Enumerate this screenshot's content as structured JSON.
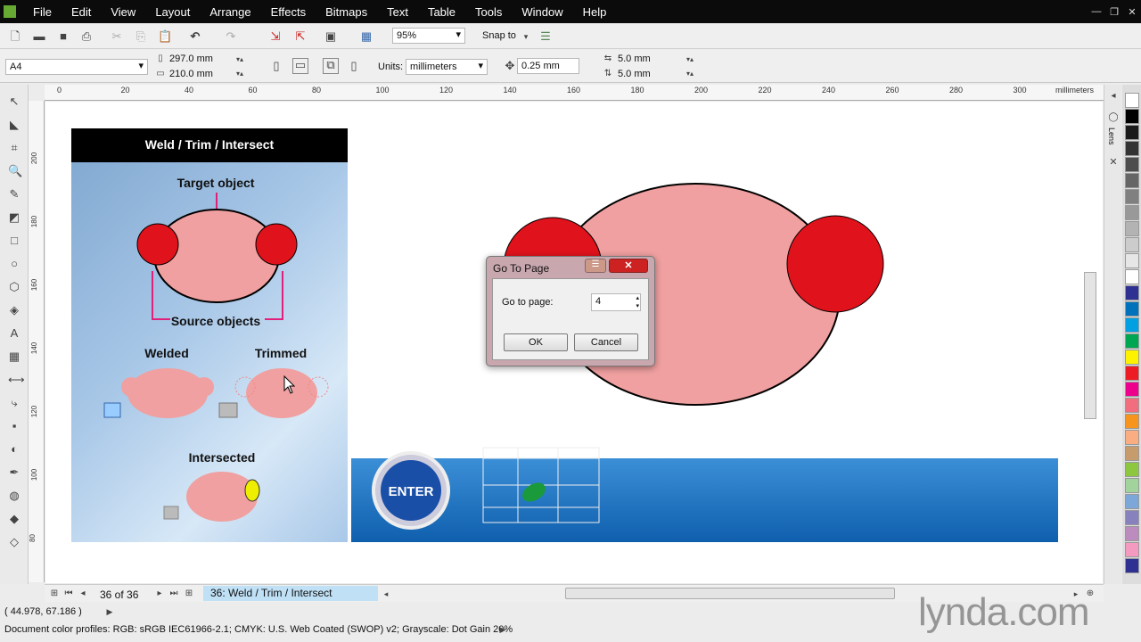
{
  "menu": [
    "File",
    "Edit",
    "View",
    "Layout",
    "Arrange",
    "Effects",
    "Bitmaps",
    "Text",
    "Table",
    "Tools",
    "Window",
    "Help"
  ],
  "toolbar": {
    "zoom": "95%",
    "snap_to": "Snap to"
  },
  "propbar": {
    "page_size": "A4",
    "width": "297.0 mm",
    "height": "210.0 mm",
    "units_label": "Units:",
    "units": "millimeters",
    "nudge": "0.25 mm",
    "dup_x": "5.0 mm",
    "dup_y": "5.0 mm"
  },
  "ruler": {
    "h_labels": [
      "0",
      "20",
      "40",
      "60",
      "80",
      "100",
      "120",
      "140",
      "160",
      "180",
      "200",
      "220",
      "240",
      "260",
      "280",
      "300"
    ],
    "h_unit": "millimeters",
    "v_labels": [
      "200",
      "180",
      "160",
      "140",
      "120",
      "100",
      "80"
    ],
    "v_unit": "millimeters"
  },
  "slide": {
    "title": "Weld / Trim / Intersect",
    "target": "Target object",
    "source": "Source objects",
    "welded": "Welded",
    "trimmed": "Trimmed",
    "intersected": "Intersected",
    "enter": "ENTER"
  },
  "dialog": {
    "title": "Go To Page",
    "label": "Go to page:",
    "value": "4",
    "ok": "OK",
    "cancel": "Cancel"
  },
  "nav": {
    "page_count": "36 of 36",
    "page_tab": "36: Weld / Trim / Intersect"
  },
  "status": {
    "coords": "( 44.978, 67.186 )",
    "profiles": "Document color profiles: RGB: sRGB IEC61966-2.1; CMYK: U.S. Web Coated (SWOP) v2; Grayscale: Dot Gain 20%"
  },
  "docker": {
    "lens_label": "Lens"
  },
  "watermark": "lynda.com",
  "palette": [
    "#ffffff",
    "#000000",
    "#1a1a1a",
    "#333333",
    "#4d4d4d",
    "#666666",
    "#808080",
    "#999999",
    "#b3b3b3",
    "#cccccc",
    "#e6e6e6",
    "#ffffff",
    "#2e3192",
    "#0072bc",
    "#00a0e3",
    "#00a651",
    "#fff200",
    "#ed1c24",
    "#ec008c",
    "#f26d7d",
    "#f7941d",
    "#f9ad81",
    "#c69c6d",
    "#8dc63f",
    "#a3d39c",
    "#7da7d9",
    "#8781bd",
    "#bd8cbf",
    "#f49ac1",
    "#2e3192"
  ]
}
